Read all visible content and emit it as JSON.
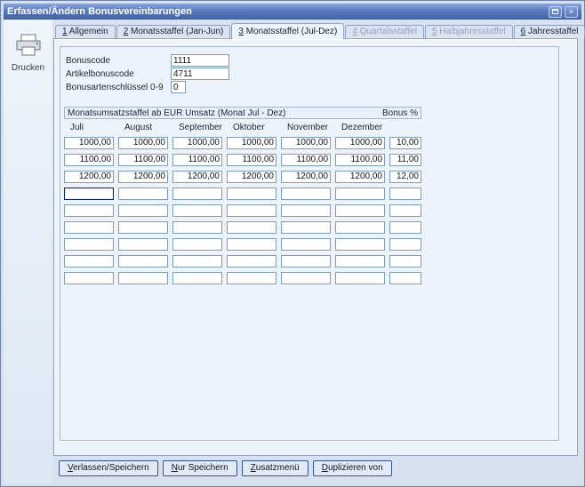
{
  "window": {
    "title": "Erfassen/Ändern Bonusvereinbarungen",
    "close_glyph": "×"
  },
  "colors": {
    "titlebar": "#587bc0",
    "client_bg": "#d7e1ef",
    "panel_bg": "#edf3fa",
    "input_border": "#7f9db9"
  },
  "sidebar": {
    "print_label": "Drucken"
  },
  "tabs": [
    {
      "mnemonic": "1",
      "label": "Allgemein",
      "state": "normal"
    },
    {
      "mnemonic": "2",
      "label": "Monatsstaffel (Jan-Jun)",
      "state": "normal"
    },
    {
      "mnemonic": "3",
      "label": "Monatsstaffel (Jul-Dez)",
      "state": "active"
    },
    {
      "mnemonic": "4",
      "label": "Quartalsstaffel",
      "state": "disabled"
    },
    {
      "mnemonic": "5",
      "label": "Halbjahresstaffel",
      "state": "disabled"
    },
    {
      "mnemonic": "6",
      "label": "Jahresstaffel",
      "state": "normal"
    }
  ],
  "form": {
    "bonuscode_label": "Bonuscode",
    "bonuscode_value": "1111",
    "artikelbonuscode_label": "Artikelbonuscode",
    "artikelbonuscode_value": "4711",
    "bonusarten_label": "Bonusartenschlüssel 0-9",
    "bonusarten_value": "0"
  },
  "staffel": {
    "title": "Monatsumsatzstaffel ab EUR Umsatz (Monat Jul - Dez)",
    "bonus_title": "Bonus %",
    "columns": [
      "Juli",
      "August",
      "September",
      "Oktober",
      "November",
      "Dezember"
    ],
    "rows": [
      {
        "months": [
          "1000,00",
          "1000,00",
          "1000,00",
          "1000,00",
          "1000,00",
          "1000,00"
        ],
        "bonus": "10,00"
      },
      {
        "months": [
          "1100,00",
          "1100,00",
          "1100,00",
          "1100,00",
          "1100,00",
          "1100,00"
        ],
        "bonus": "11,00"
      },
      {
        "months": [
          "1200,00",
          "1200,00",
          "1200,00",
          "1200,00",
          "1200,00",
          "1200,00"
        ],
        "bonus": "12,00"
      },
      {
        "months": [
          "",
          "",
          "",
          "",
          "",
          ""
        ],
        "bonus": ""
      },
      {
        "months": [
          "",
          "",
          "",
          "",
          "",
          ""
        ],
        "bonus": ""
      },
      {
        "months": [
          "",
          "",
          "",
          "",
          "",
          ""
        ],
        "bonus": ""
      },
      {
        "months": [
          "",
          "",
          "",
          "",
          "",
          ""
        ],
        "bonus": ""
      },
      {
        "months": [
          "",
          "",
          "",
          "",
          "",
          ""
        ],
        "bonus": ""
      },
      {
        "months": [
          "",
          "",
          "",
          "",
          "",
          ""
        ],
        "bonus": ""
      }
    ],
    "focused_cell": {
      "row": 3,
      "col": 0
    }
  },
  "footer_buttons": [
    "Verlassen/Speichern",
    "Nur Speichern",
    "Zusatzmenü",
    "Duplizieren von"
  ]
}
